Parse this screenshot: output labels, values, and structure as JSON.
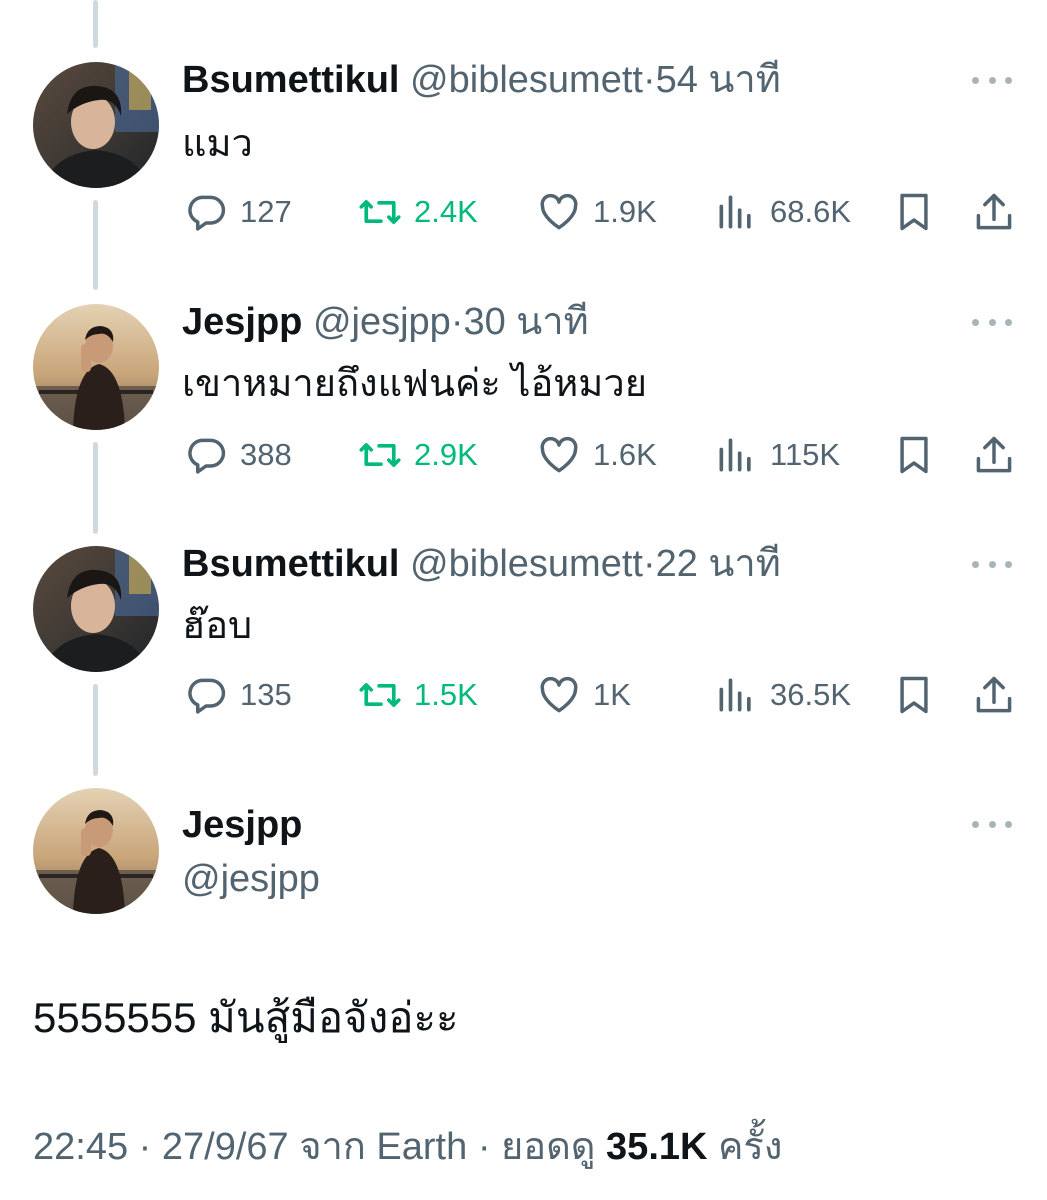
{
  "tweets": [
    {
      "display_name": "Bsumettikul",
      "handle": "@biblesumett",
      "separator": "·",
      "time": "54 นาที",
      "text": "แมว",
      "replies": "127",
      "retweets": "2.4K",
      "likes": "1.9K",
      "views": "68.6K"
    },
    {
      "display_name": "Jesjpp",
      "handle": "@jesjpp",
      "separator": "·",
      "time": "30 นาที",
      "text": "เขาหมายถึงแฟนค่ะ ไอ้หมวย",
      "replies": "388",
      "retweets": "2.9K",
      "likes": "1.6K",
      "views": "115K"
    },
    {
      "display_name": "Bsumettikul",
      "handle": "@biblesumett",
      "separator": "·",
      "time": "22 นาที",
      "text": "ฮ๊อบ",
      "replies": "135",
      "retweets": "1.5K",
      "likes": "1K",
      "views": "36.5K"
    }
  ],
  "main_tweet": {
    "display_name": "Jesjpp",
    "handle": "@jesjpp",
    "text": "5555555 มันสู้มือจังอ่ะะ",
    "time": "22:45",
    "separator": "·",
    "date": "27/9/67",
    "source_prefix": "จาก",
    "source": "Earth",
    "views_prefix": "ยอดดู",
    "views": "35.1K",
    "views_suffix": "ครั้ง"
  },
  "icons": {
    "reply": "reply-bubble-icon",
    "retweet": "retweet-icon",
    "like": "heart-icon",
    "views": "views-bars-icon",
    "bookmark": "bookmark-icon",
    "share": "share-upload-icon",
    "more": "more-dots-icon"
  },
  "colors": {
    "retweet_active": "#00ba7c",
    "secondary_text": "#536471",
    "primary_text": "#0f1419",
    "thread_line": "#cfd9de"
  }
}
